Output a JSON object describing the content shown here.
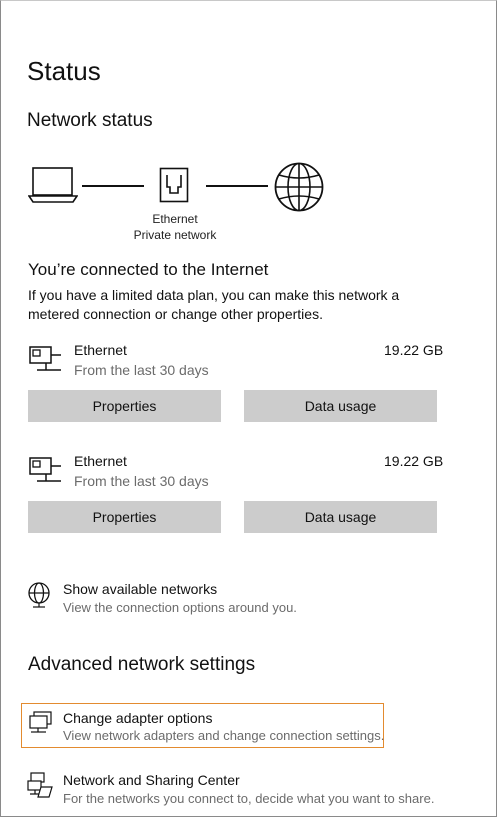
{
  "page": {
    "title": "Status"
  },
  "network_status": {
    "heading": "Network status",
    "diagram": {
      "adapter_label": "Ethernet",
      "network_label": "Private network",
      "icons": [
        "laptop-icon",
        "ethernet-port-icon",
        "globe-icon"
      ]
    },
    "connected_heading": "You’re connected to the Internet",
    "description": "If you have a limited data plan, you can make this network a metered connection or change other properties."
  },
  "connections": [
    {
      "name": "Ethernet",
      "subtitle": "From the last 30 days",
      "usage": "19.22 GB",
      "properties_label": "Properties",
      "data_usage_label": "Data usage",
      "icon": "ethernet-network-icon"
    },
    {
      "name": "Ethernet",
      "subtitle": "From the last 30 days",
      "usage": "19.22 GB",
      "properties_label": "Properties",
      "data_usage_label": "Data usage",
      "icon": "ethernet-network-icon"
    }
  ],
  "show_networks": {
    "title": "Show available networks",
    "subtitle": "View the connection options around you.",
    "icon": "globe-network-icon"
  },
  "advanced": {
    "heading": "Advanced network settings",
    "items": [
      {
        "title": "Change adapter options",
        "subtitle": "View network adapters and change connection settings.",
        "icon": "adapter-icon",
        "highlighted": true
      },
      {
        "title": "Network and Sharing Center",
        "subtitle": "For the networks you connect to, decide what you want to share.",
        "icon": "sharing-center-icon",
        "highlighted": false
      }
    ]
  },
  "colors": {
    "button_bg": "#cccccc",
    "subtext": "#6b6b6b",
    "highlight_border": "#e38b2f"
  }
}
